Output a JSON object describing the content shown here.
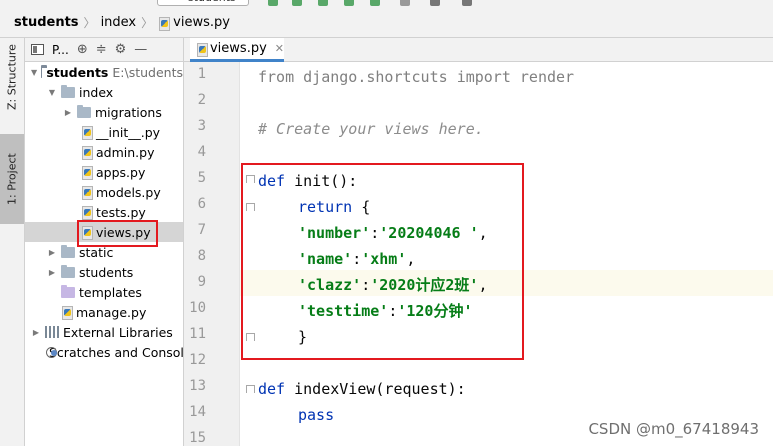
{
  "toolbar": {
    "run_config": "students"
  },
  "breadcrumb": {
    "root": "students",
    "folder": "index",
    "file": "views.py"
  },
  "tool_stripe": {
    "structure": "Z: Structure",
    "project": "1: Project"
  },
  "project_panel": {
    "view_label": "P..."
  },
  "tree": {
    "root_name": "students",
    "root_path": "E:\\students",
    "items": [
      {
        "label": "index"
      },
      {
        "label": "migrations"
      },
      {
        "label": "__init__.py"
      },
      {
        "label": "admin.py"
      },
      {
        "label": "apps.py"
      },
      {
        "label": "models.py"
      },
      {
        "label": "tests.py"
      },
      {
        "label": "views.py"
      },
      {
        "label": "static"
      },
      {
        "label": "students"
      },
      {
        "label": "templates"
      },
      {
        "label": "manage.py"
      },
      {
        "label": "External Libraries"
      },
      {
        "label": "Scratches and Consoles"
      }
    ]
  },
  "editor": {
    "tab_label": "views.py",
    "line_numbers": [
      "1",
      "2",
      "3",
      "4",
      "5",
      "6",
      "7",
      "8",
      "9",
      "10",
      "11",
      "12",
      "13",
      "14",
      "15"
    ],
    "highlighted_line": 9,
    "code": {
      "l1_kw1": "from",
      "l1_mod": " django.shortcuts ",
      "l1_kw2": "import",
      "l1_name": " render",
      "l3_comment": "# Create your views here.",
      "l5_kw": "def",
      "l5_rest": " init():",
      "l6_kw": "return",
      "l6_rest": " {",
      "l7_key": "'number'",
      "l7_val": "'20204046 '",
      "l8_key": "'name'",
      "l8_val": "'xhm'",
      "l9_key": "'clazz'",
      "l9_val": "'2020计应2班'",
      "l10_key": "'testtime'",
      "l10_val": "'120分钟'",
      "l11": "}",
      "l13_kw": "def",
      "l13_rest": " indexView(request):",
      "l14_kw": "pass",
      "colon": ":",
      "comma": ","
    }
  },
  "watermark": "CSDN @m0_67418943",
  "colors": {
    "keyword": "#0033b3",
    "string": "#067d17",
    "comment": "#8c8c8c",
    "annotation_box": "#e3191f",
    "active_tab_underline": "#4083c9"
  }
}
